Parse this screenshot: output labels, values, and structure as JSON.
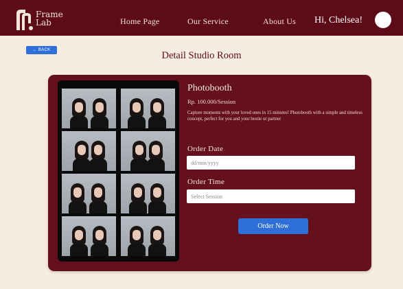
{
  "brand": {
    "line1": "Frame",
    "line2": "Lab"
  },
  "nav": {
    "home": "Home Page",
    "service": "Our Service",
    "about": "About Us",
    "greeting": "Hi, Chelsea!"
  },
  "back_label": "← BACK",
  "page_title": "Detail Studio Room",
  "service": {
    "name": "Photobooth",
    "price": "Rp. 100.000/Session",
    "description": "Capture moments with your loved ones in 15 minutes! Photobooth with a simple and timeless concept, perfect for you and your bestie or partner"
  },
  "form": {
    "date_label": "Order Date",
    "date_placeholder": "dd/mm/yyyy",
    "time_label": "Order Time",
    "time_placeholder": "Select Session",
    "submit_label": "Order Now"
  },
  "colors": {
    "maroon": "#5d0a19",
    "card": "#65101d",
    "background": "#f6ecdf",
    "accent_blue": "#2f6fd8"
  }
}
